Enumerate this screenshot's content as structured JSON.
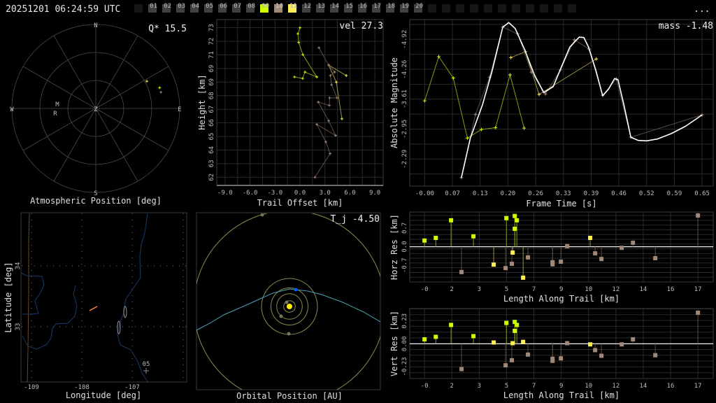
{
  "header": {
    "timestamp": "20251201 06:24:59 UTC",
    "menu_label": "...",
    "frames": [
      {
        "label": "",
        "state": "empty"
      },
      {
        "label": "01",
        "state": "off"
      },
      {
        "label": "02",
        "state": "off"
      },
      {
        "label": "03",
        "state": "off"
      },
      {
        "label": "04",
        "state": "off"
      },
      {
        "label": "05",
        "state": "off"
      },
      {
        "label": "06",
        "state": "off"
      },
      {
        "label": "07",
        "state": "off"
      },
      {
        "label": "08",
        "state": "off"
      },
      {
        "label": "09",
        "state": "lime"
      },
      {
        "label": "10",
        "state": "tan"
      },
      {
        "label": "11",
        "state": "yellow"
      },
      {
        "label": "12",
        "state": "off"
      },
      {
        "label": "13",
        "state": "off"
      },
      {
        "label": "14",
        "state": "off"
      },
      {
        "label": "15",
        "state": "off"
      },
      {
        "label": "16",
        "state": "off"
      },
      {
        "label": "17",
        "state": "off"
      },
      {
        "label": "18",
        "state": "off"
      },
      {
        "label": "19",
        "state": "off"
      },
      {
        "label": "20",
        "state": "off"
      },
      {
        "label": "",
        "state": "empty"
      },
      {
        "label": "",
        "state": "empty"
      },
      {
        "label": "",
        "state": "empty"
      },
      {
        "label": "",
        "state": "empty"
      },
      {
        "label": "",
        "state": "empty"
      },
      {
        "label": "",
        "state": "empty"
      },
      {
        "label": "",
        "state": "empty"
      },
      {
        "label": "",
        "state": "empty"
      },
      {
        "label": "",
        "state": "empty"
      },
      {
        "label": "",
        "state": "empty"
      },
      {
        "label": "",
        "state": "empty"
      }
    ]
  },
  "colors": {
    "lime": "#ccff00",
    "yellow": "#ffee55",
    "tan": "#a08878",
    "lime_line": "#8a9a10",
    "yellow_line": "#9a9040",
    "tan_line": "#5c4c42",
    "off": "#404040",
    "empty": "#161616",
    "fit": "#ffffff",
    "orbit": "#8a8a50",
    "trajectory": "#4aa0b0",
    "earth": "#0060ff",
    "sun": "#ffee00",
    "river": "#1a3a6a",
    "border": "#6a4a20",
    "trail": "#ff8844"
  },
  "chart_data": [
    {
      "id": "atmospheric",
      "type": "scatter",
      "title": "Atmospheric Position [deg]",
      "stat_label": "Q* 15.5",
      "directions": {
        "n": "N",
        "s": "S",
        "e": "E",
        "w": "W",
        "z": "Z"
      },
      "stations": [
        "M",
        "R"
      ],
      "points": [
        {
          "series": "yellow",
          "az": 62,
          "zen": 62
        },
        {
          "series": "lime",
          "az": 72,
          "zen": 72
        },
        {
          "series": "tan",
          "az": 76,
          "zen": 72
        }
      ]
    },
    {
      "id": "height",
      "type": "line",
      "stat_label": "vel 27.3",
      "xlabel": "Trail Offset [km]",
      "ylabel": "Height [km]",
      "xticks": [
        "-9.0",
        "-6.0",
        "-3.0",
        "0.0",
        "3.0",
        "6.0",
        "9.0"
      ],
      "xtick_values": [
        -9,
        -6,
        -3,
        0,
        3,
        6,
        9
      ],
      "yticks": [
        "62",
        "63",
        "64",
        "65",
        "66",
        "67",
        "68",
        "69",
        "71",
        "72",
        "73"
      ],
      "ytick_values": [
        62,
        63,
        64,
        65,
        66,
        67,
        68,
        69,
        70,
        71,
        72,
        73
      ],
      "yticks_shown": [
        "62",
        "63",
        "64",
        "65",
        "66",
        "67",
        "68",
        "69",
        "69",
        "71",
        "72",
        "73"
      ],
      "xlim": [
        -10,
        10
      ],
      "ylim": [
        61.4,
        73.6
      ],
      "series": [
        {
          "name": "lime",
          "x": [
            0,
            -0.25,
            -0.15,
            0.35,
            2.02,
            0.6,
            0.32,
            -0.66
          ],
          "y": [
            73.0,
            72.56,
            71.92,
            71.02,
            69.38,
            69.74,
            69.27,
            69.38
          ]
        },
        {
          "name": "yellow",
          "x": [
            5.57,
            3.45,
            4.37,
            5.04
          ],
          "y": [
            69.48,
            70.25,
            69.0,
            66.3
          ]
        },
        {
          "name": "tan",
          "x": [
            2.28,
            3.45,
            4.18,
            3.65,
            3.8,
            4.45,
            3.56,
            3.53,
            2.2,
            3.45,
            4.29,
            2.02,
            3.11,
            3.62,
            1.8
          ],
          "y": [
            71.53,
            70.25,
            69.74,
            69.48,
            68.81,
            67.84,
            67.84,
            67.29,
            67.53,
            66.15,
            65.07,
            65.89,
            64.6,
            63.74,
            62.0
          ]
        }
      ]
    },
    {
      "id": "magnitude",
      "type": "line",
      "stat_label": "mass -1.48",
      "xlabel": "Frame Time [s]",
      "ylabel": "Absolute Magnitude",
      "xticks": [
        "-0.00",
        "0.07",
        "0.13",
        "0.20",
        "0.26",
        "0.33",
        "0.39",
        "0.46",
        "0.52",
        "0.59",
        "0.65"
      ],
      "yticks": [
        "-4.92",
        "-4.26",
        "-3.61",
        "-2.95",
        "-2.29"
      ],
      "ytick_values": [
        -4.92,
        -4.26,
        -3.61,
        -2.95,
        -2.29
      ],
      "xlim": [
        -0.035,
        0.676
      ],
      "ylim": [
        -5.355,
        -1.695
      ],
      "series": [
        {
          "name": "lime",
          "x": [
            0,
            0.033,
            0.067,
            0.1,
            0.133,
            0.166,
            0.2,
            0.233
          ],
          "y": [
            -3.57,
            -4.54,
            -4.07,
            -2.75,
            -2.94,
            -2.98,
            -4.14,
            -2.97
          ]
        },
        {
          "name": "yellow",
          "x": [
            0.202,
            0.236,
            0.268,
            0.402
          ],
          "y": [
            -4.52,
            -4.65,
            -3.71,
            -4.49
          ]
        },
        {
          "name": "tan",
          "x": [
            0.086,
            0.119,
            0.152,
            0.183,
            0.218,
            0.25,
            0.283,
            0.318,
            0.351,
            0.385,
            0.417,
            0.449,
            0.483,
            0.65
          ],
          "y": [
            -1.88,
            -3.27,
            -4.09,
            -5.19,
            -5.04,
            -4.2,
            -3.72,
            -4.25,
            -4.91,
            -4.71,
            -3.69,
            -4.05,
            -2.77,
            -3.26
          ]
        },
        {
          "name": "fit",
          "x": [
            0.086,
            0.107,
            0.135,
            0.157,
            0.183,
            0.197,
            0.212,
            0.234,
            0.257,
            0.279,
            0.301,
            0.317,
            0.34,
            0.362,
            0.373,
            0.384,
            0.401,
            0.417,
            0.431,
            0.445,
            0.453,
            0.467,
            0.483,
            0.5,
            0.52,
            0.545,
            0.578,
            0.611,
            0.65
          ],
          "y": [
            -1.88,
            -2.75,
            -3.47,
            -4.19,
            -5.19,
            -5.29,
            -5.16,
            -4.7,
            -4.14,
            -3.75,
            -3.88,
            -4.24,
            -4.75,
            -4.97,
            -4.96,
            -4.75,
            -4.24,
            -3.68,
            -3.83,
            -4.06,
            -4.03,
            -3.47,
            -2.77,
            -2.7,
            -2.69,
            -2.73,
            -2.85,
            -3.01,
            -3.26
          ]
        }
      ]
    },
    {
      "id": "map",
      "type": "scatter",
      "xlabel": "Longitude [deg]",
      "ylabel": "Latitude [deg]",
      "xticks": [
        "-109",
        "-108",
        "-107"
      ],
      "yticks": [
        "34",
        "33"
      ],
      "station_label": "05"
    },
    {
      "id": "orbit",
      "type": "scatter",
      "title": "Orbital Position [AU]",
      "stat_label": "T_j -4.50"
    },
    {
      "id": "horz_res",
      "type": "scatter",
      "xlabel": "Length Along Trail [km]",
      "ylabel": "Horz Res [km]",
      "xticks": [
        "-0",
        "2",
        "3",
        "5",
        "7",
        "9",
        "10",
        "12",
        "14",
        "16",
        "17"
      ],
      "yticks": [
        "0.7",
        "0.0",
        "-0.7"
      ],
      "ytick_values": [
        0.7,
        0,
        -0.7
      ],
      "xlim": [
        -0.92,
        17.95
      ],
      "ylim": [
        -1.32,
        1.3
      ],
      "series": [
        {
          "name": "lime",
          "x": [
            0,
            0.7,
            1.65,
            3.04,
            5.09,
            5.61,
            5.74,
            5.61
          ],
          "y": [
            0.23,
            0.33,
            0.99,
            0.39,
            1.07,
            1.15,
            0.99,
            0.67
          ]
        },
        {
          "name": "yellow",
          "x": [
            4.3,
            5.48,
            6.13,
            10.3
          ],
          "y": [
            -0.67,
            -0.22,
            -1.16,
            0.33
          ]
        },
        {
          "name": "tan",
          "x": [
            2.3,
            5.04,
            5.43,
            6.43,
            7.96,
            7.96,
            8.48,
            8.87,
            10.61,
            11.0,
            12.26,
            12.96,
            14.35,
            17.0
          ],
          "y": [
            -0.95,
            -0.8,
            -0.64,
            -0.4,
            -0.58,
            -0.66,
            -0.56,
            0.02,
            -0.25,
            -0.46,
            -0.04,
            0.15,
            -0.43,
            1.17
          ]
        }
      ]
    },
    {
      "id": "vert_res",
      "type": "scatter",
      "xlabel": "Length Along Trail [km]",
      "ylabel": "Vert Res [km]",
      "xticks": [
        "-0",
        "2",
        "3",
        "5",
        "7",
        "9",
        "10",
        "12",
        "14",
        "16",
        "17"
      ],
      "yticks": [
        "0.23",
        "0.00",
        "-0.23"
      ],
      "ytick_values": [
        0.23,
        0,
        -0.23
      ],
      "xlim": [
        -0.92,
        17.95
      ],
      "ylim": [
        -0.35,
        0.355
      ],
      "series": [
        {
          "name": "lime",
          "x": [
            0,
            0.7,
            1.65,
            3.04,
            5.09,
            5.61,
            5.74,
            5.61
          ],
          "y": [
            0.045,
            0.07,
            0.19,
            0.077,
            0.21,
            0.22,
            0.19,
            0.13
          ]
        },
        {
          "name": "yellow",
          "x": [
            4.3,
            5.48,
            6.13,
            10.3
          ],
          "y": [
            0.013,
            0.006,
            0.019,
            -0.006
          ]
        },
        {
          "name": "tan",
          "x": [
            2.3,
            5.04,
            5.43,
            6.43,
            7.96,
            7.96,
            8.48,
            8.87,
            10.61,
            11.0,
            12.26,
            12.96,
            14.35,
            17.0
          ],
          "y": [
            -0.255,
            -0.217,
            -0.166,
            -0.109,
            -0.151,
            -0.172,
            -0.147,
            0.006,
            -0.064,
            -0.121,
            -0.006,
            0.045,
            -0.115,
            0.313
          ]
        }
      ]
    }
  ]
}
